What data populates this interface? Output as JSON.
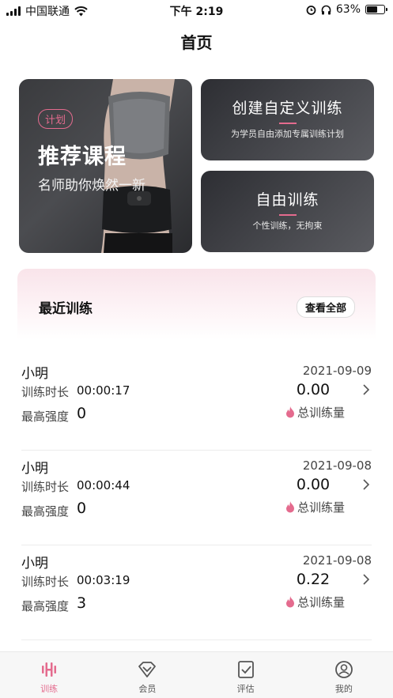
{
  "status_bar": {
    "carrier": "中国联通",
    "time": "下午 2:19",
    "battery": "63%"
  },
  "header": {
    "title": "首页"
  },
  "banners": {
    "main": {
      "tag": "计划",
      "title": "推荐课程",
      "subtitle": "名师助你焕然一新"
    },
    "custom": {
      "title": "创建自定义训练",
      "subtitle": "为学员自由添加专属训练计划"
    },
    "free": {
      "title": "自由训练",
      "subtitle": "个性训练，无拘束"
    }
  },
  "recent": {
    "title": "最近训练",
    "view_all": "查看全部",
    "duration_label": "训练时长",
    "intensity_label": "最高强度",
    "total_label": "总训练量",
    "items": [
      {
        "name": "小明",
        "date": "2021-09-09",
        "duration": "00:00:17",
        "intensity": "0",
        "total": "0.00"
      },
      {
        "name": "小明",
        "date": "2021-09-08",
        "duration": "00:00:44",
        "intensity": "0",
        "total": "0.00"
      },
      {
        "name": "小明",
        "date": "2021-09-08",
        "duration": "00:03:19",
        "intensity": "3",
        "total": "0.22"
      }
    ]
  },
  "tabs": [
    {
      "label": "训练",
      "icon": "training-icon",
      "active": true
    },
    {
      "label": "会员",
      "icon": "member-icon",
      "active": false
    },
    {
      "label": "评估",
      "icon": "assessment-icon",
      "active": false
    },
    {
      "label": "我的",
      "icon": "profile-icon",
      "active": false
    }
  ],
  "colors": {
    "accent": "#e46b8e",
    "card_dark": "#3a3b3e"
  }
}
